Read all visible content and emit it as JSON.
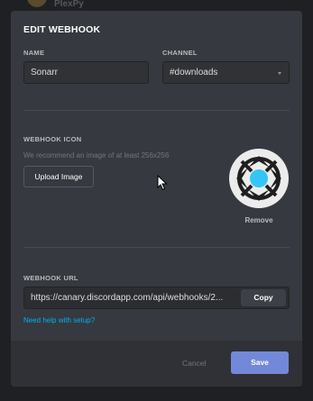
{
  "background": {
    "app_name": "PlexPy"
  },
  "modal": {
    "title": "EDIT WEBHOOK",
    "name": {
      "label": "NAME",
      "value": "Sonarr"
    },
    "channel": {
      "label": "CHANNEL",
      "value": "#downloads",
      "icon": "chevron-down-icon"
    },
    "icon_section": {
      "label": "WEBHOOK ICON",
      "hint": "We recommend an image of at least 256x256",
      "upload_label": "Upload Image",
      "remove_label": "Remove",
      "avatar_icon": "sonarr-logo-icon"
    },
    "url_section": {
      "label": "WEBHOOK URL",
      "value": "https://canary.discordapp.com/api/webhooks/2...",
      "copy_label": "Copy",
      "help_link": "Need help with setup?"
    },
    "footer": {
      "cancel_label": "Cancel",
      "save_label": "Save"
    }
  },
  "colors": {
    "modal_bg": "#36393f",
    "footer_bg": "#2f3136",
    "accent": "#7289da",
    "link": "#00b0f4",
    "sonarr_blue": "#35c5f4"
  }
}
